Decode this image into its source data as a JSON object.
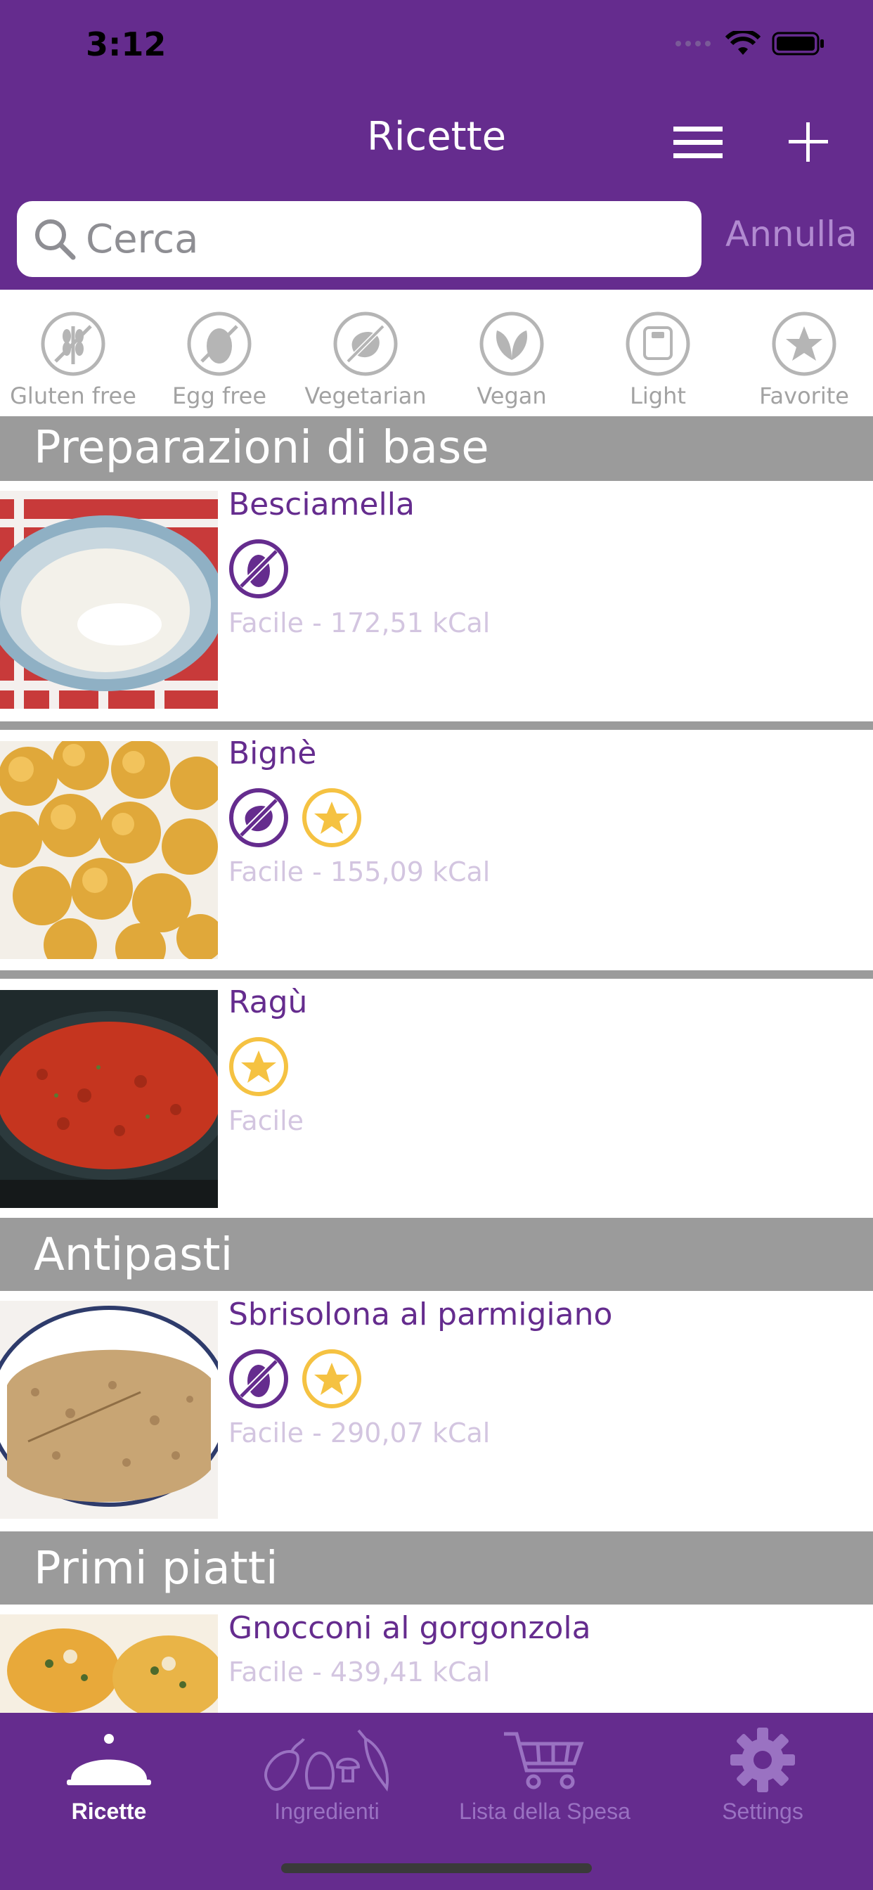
{
  "status": {
    "time": "3:12"
  },
  "nav": {
    "title": "Ricette",
    "menu_icon": "hamburger-icon",
    "add_icon": "plus-icon"
  },
  "search": {
    "placeholder": "Cerca",
    "value": "",
    "cancel_label": "Annulla"
  },
  "filters": [
    {
      "label": "Gluten free",
      "icon": "wheat-icon"
    },
    {
      "label": "Egg free",
      "icon": "egg-icon"
    },
    {
      "label": "Vegetarian",
      "icon": "meat-icon"
    },
    {
      "label": "Vegan",
      "icon": "leaf-icon"
    },
    {
      "label": "Light",
      "icon": "scale-icon"
    },
    {
      "label": "Favorite",
      "icon": "star-icon"
    }
  ],
  "sections": [
    {
      "title": "Preparazioni di base"
    },
    {
      "title": "Antipasti"
    },
    {
      "title": "Primi piatti"
    }
  ],
  "recipes": [
    {
      "title": "Besciamella",
      "subtitle": "Facile - 172,51 kCal",
      "badges": [
        "egg-free"
      ]
    },
    {
      "title": "Bignè",
      "subtitle": "Facile - 155,09 kCal",
      "badges": [
        "vegetarian",
        "favorite"
      ]
    },
    {
      "title": "Ragù",
      "subtitle": "Facile",
      "badges": [
        "favorite"
      ]
    },
    {
      "title": "Sbrisolona al parmigiano",
      "subtitle": "Facile - 290,07 kCal",
      "badges": [
        "egg-free",
        "favorite"
      ]
    },
    {
      "title": "Gnocconi al gorgonzola",
      "subtitle": "Facile - 439,41 kCal",
      "badges": []
    }
  ],
  "tabs": [
    {
      "label": "Ricette",
      "icon": "cloche-icon",
      "active": true
    },
    {
      "label": "Ingredienti",
      "icon": "vegetables-icon",
      "active": false
    },
    {
      "label": "Lista della Spesa",
      "icon": "cart-icon",
      "active": false
    },
    {
      "label": "Settings",
      "icon": "gear-icon",
      "active": false
    }
  ],
  "colors": {
    "brand": "#652c8e",
    "section": "#9b9b9b",
    "favorite": "#f5c242",
    "subtitle": "#d3c5e0"
  }
}
